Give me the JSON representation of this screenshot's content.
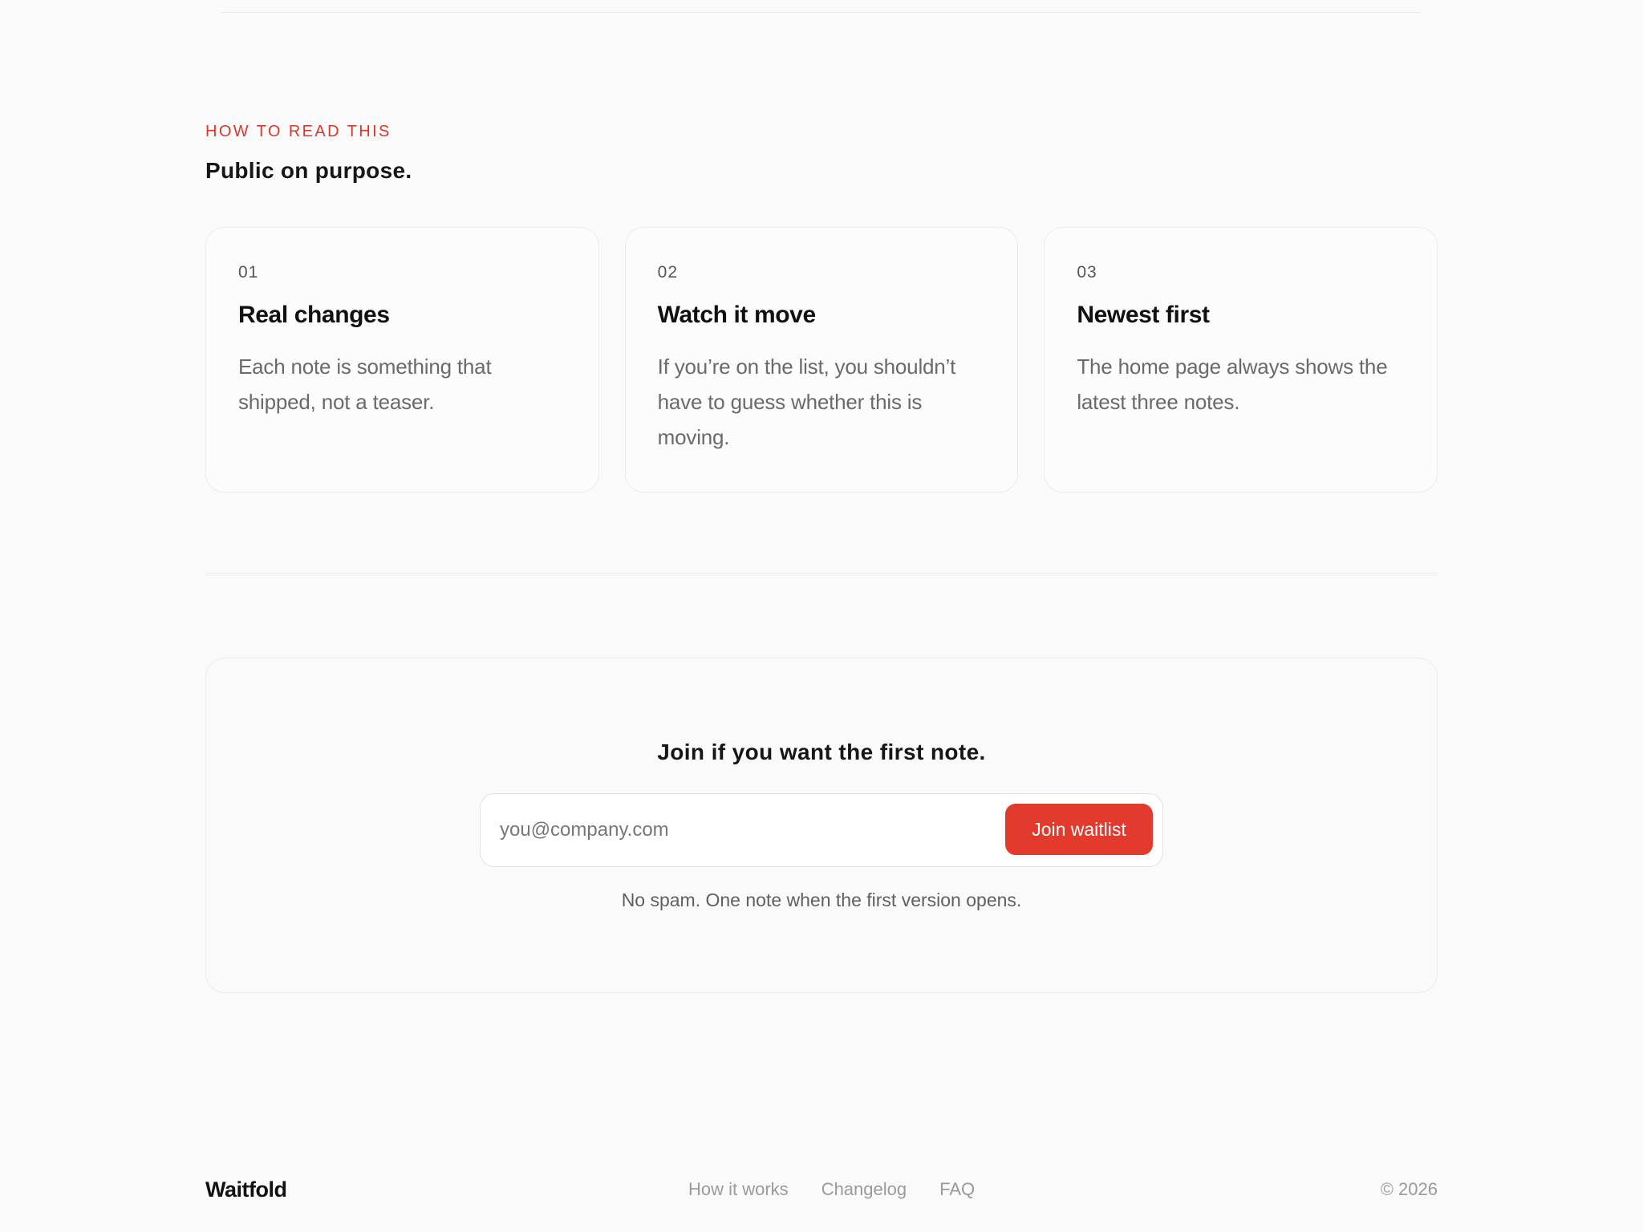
{
  "section": {
    "eyebrow": "HOW TO READ THIS",
    "title": "Public on purpose."
  },
  "cards": [
    {
      "number": "01",
      "title": "Real changes",
      "text": "Each note is something that shipped, not a teaser."
    },
    {
      "number": "02",
      "title": "Watch it move",
      "text": "If you’re on the list, you shouldn’t have to guess whether this is moving."
    },
    {
      "number": "03",
      "title": "Newest first",
      "text": "The home page always shows the latest three notes."
    }
  ],
  "cta": {
    "title": "Join if you want the first note.",
    "email_placeholder": "you@company.com",
    "email_value": "",
    "button_label": "Join waitlist",
    "note": "No spam. One note when the first version opens."
  },
  "footer": {
    "brand": "Waitfold",
    "links": [
      "How it works",
      "Changelog",
      "FAQ"
    ],
    "copyright": "© 2026"
  },
  "colors": {
    "accent": "#e23a2d",
    "eyebrow": "#d6392c",
    "background": "#fafafa"
  }
}
